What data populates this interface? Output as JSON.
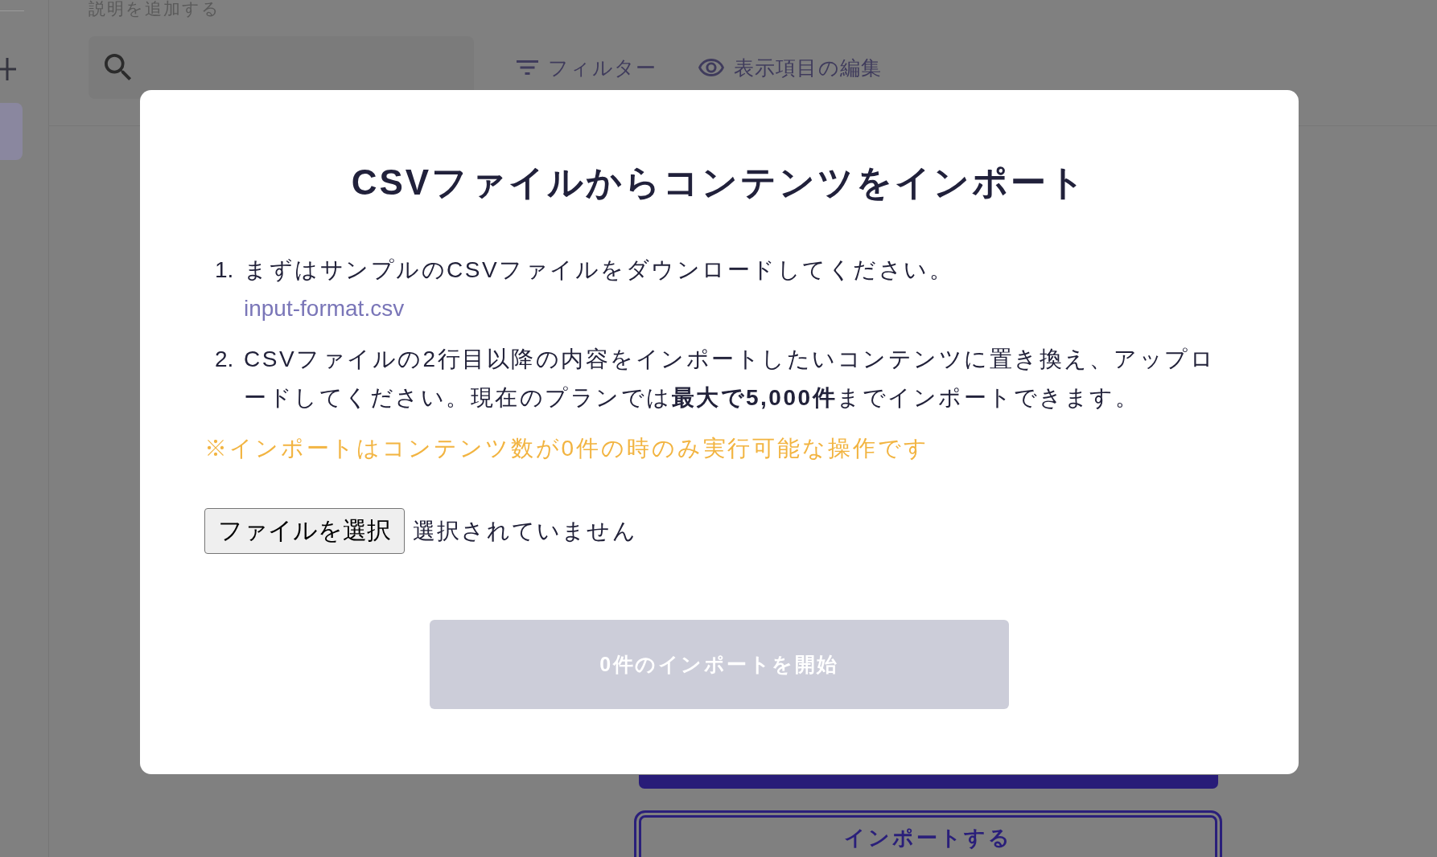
{
  "description_prompt": "説明を追加する",
  "sidebar": {
    "items": [
      {
        "selected": true
      }
    ]
  },
  "toolbar": {
    "buttons": [
      {
        "kind": "filter",
        "label": "フィルター"
      },
      {
        "kind": "columns",
        "label": "表示項目の編集"
      }
    ]
  },
  "background_buttons": [
    {
      "kind": "filled"
    },
    {
      "kind": "outlined",
      "label": "インポートする"
    }
  ],
  "modal": {
    "title": "CSVファイルからコンテンツをインポート",
    "steps": [
      {
        "number": "1.",
        "text": "まずはサンプルのCSVファイルをダウンロードしてください。",
        "link": "input-format.csv"
      },
      {
        "number": "2.",
        "text": "CSVファイルの2行目以降の内容をインポートしたいコンテンツに置き換え、アップロードしてください。現在のプランでは**最大で5,000件**までインポートできます。"
      }
    ],
    "notice": "※インポートはコンテンツ数が0件の時のみ実行可能な操作です",
    "file_input": {
      "button_label": "ファイルを選択",
      "status": "選択されていません"
    },
    "import_button": {
      "label": "0件のインポートを開始",
      "disabled": true
    }
  }
}
